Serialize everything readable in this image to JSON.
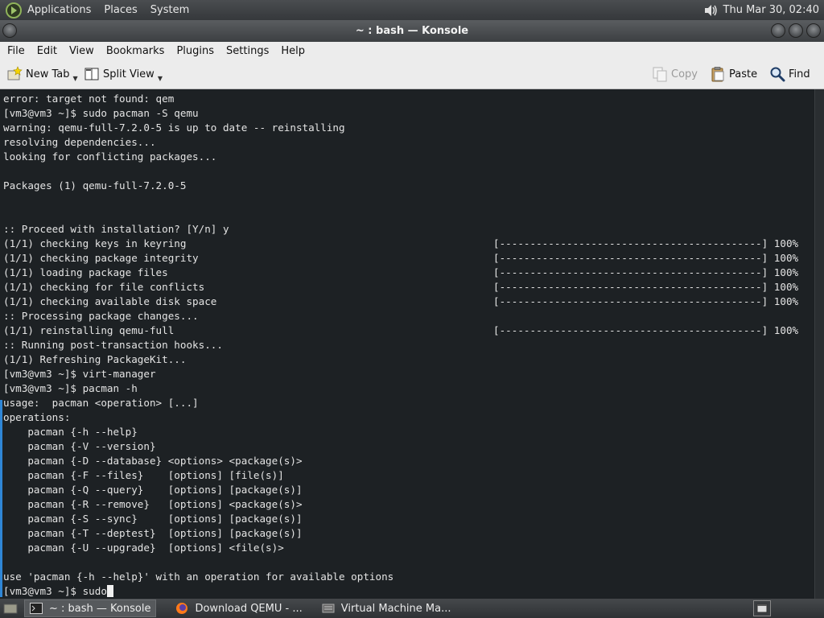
{
  "top_panel": {
    "applications": "Applications",
    "places": "Places",
    "system": "System",
    "clock": "Thu Mar 30, 02:40"
  },
  "window": {
    "title": "~ : bash — Konsole"
  },
  "menubar": {
    "items": [
      {
        "label": "File"
      },
      {
        "label": "Edit"
      },
      {
        "label": "View"
      },
      {
        "label": "Bookmarks"
      },
      {
        "label": "Plugins"
      },
      {
        "label": "Settings"
      },
      {
        "label": "Help"
      }
    ]
  },
  "toolbar": {
    "new_tab": "New Tab",
    "split_view": "Split View",
    "copy": "Copy",
    "paste": "Paste",
    "find": "Find"
  },
  "terminal": {
    "lines": [
      {
        "text": "error: target not found: qem"
      },
      {
        "text": "[vm3@vm3 ~]$ sudo pacman -S qemu"
      },
      {
        "text": "warning: qemu-full-7.2.0-5 is up to date -- reinstalling"
      },
      {
        "text": "resolving dependencies..."
      },
      {
        "text": "looking for conflicting packages..."
      },
      {
        "text": ""
      },
      {
        "text": "Packages (1) qemu-full-7.2.0-5"
      },
      {
        "text": ""
      },
      {
        "text": ""
      },
      {
        "text": ":: Proceed with installation? [Y/n] y"
      },
      {
        "text": "(1/1) checking keys in keyring",
        "bar": "[-------------------------------------------] 100%"
      },
      {
        "text": "(1/1) checking package integrity",
        "bar": "[-------------------------------------------] 100%"
      },
      {
        "text": "(1/1) loading package files",
        "bar": "[-------------------------------------------] 100%"
      },
      {
        "text": "(1/1) checking for file conflicts",
        "bar": "[-------------------------------------------] 100%"
      },
      {
        "text": "(1/1) checking available disk space",
        "bar": "[-------------------------------------------] 100%"
      },
      {
        "text": ":: Processing package changes..."
      },
      {
        "text": "(1/1) reinstalling qemu-full",
        "bar": "[-------------------------------------------] 100%"
      },
      {
        "text": ":: Running post-transaction hooks..."
      },
      {
        "text": "(1/1) Refreshing PackageKit..."
      },
      {
        "text": "[vm3@vm3 ~]$ virt-manager"
      },
      {
        "text": "[vm3@vm3 ~]$ pacman -h"
      },
      {
        "text": "usage:  pacman <operation> [...]"
      },
      {
        "text": "operations:"
      },
      {
        "text": "    pacman {-h --help}"
      },
      {
        "text": "    pacman {-V --version}"
      },
      {
        "text": "    pacman {-D --database} <options> <package(s)>"
      },
      {
        "text": "    pacman {-F --files}    [options] [file(s)]"
      },
      {
        "text": "    pacman {-Q --query}    [options] [package(s)]"
      },
      {
        "text": "    pacman {-R --remove}   [options] <package(s)>"
      },
      {
        "text": "    pacman {-S --sync}     [options] [package(s)]"
      },
      {
        "text": "    pacman {-T --deptest}  [options] [package(s)]"
      },
      {
        "text": "    pacman {-U --upgrade}  [options] <file(s)>"
      },
      {
        "text": ""
      },
      {
        "text": "use 'pacman {-h --help}' with an operation for available options"
      }
    ],
    "prompt": "[vm3@vm3 ~]$ sudo"
  },
  "taskbar": {
    "tasks": [
      {
        "label": "~ : bash — Konsole",
        "icon": "terminal-icon",
        "active": true
      },
      {
        "label": "Download QEMU - ...",
        "icon": "firefox-icon",
        "active": false
      },
      {
        "label": "Virtual Machine Ma...",
        "icon": "virt-manager-icon",
        "active": false
      }
    ]
  }
}
